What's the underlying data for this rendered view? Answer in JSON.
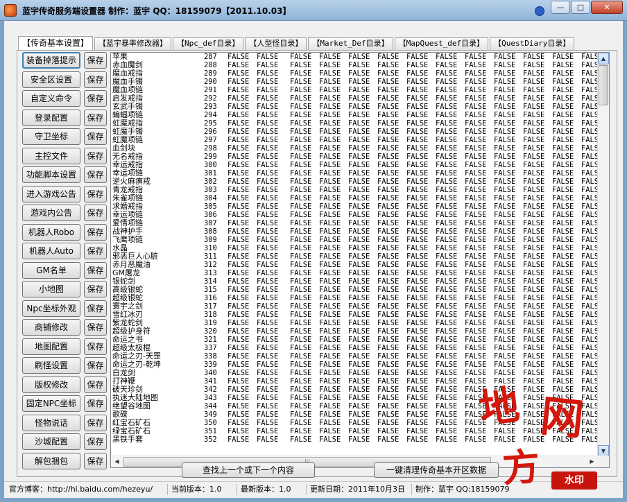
{
  "window": {
    "title": "蓝宇传奇服务端设置器 制作：蓝宇 QQ：18159079【2011.10.03】",
    "min_glyph": "—",
    "max_glyph": "□",
    "close_glyph": "✕"
  },
  "tabs": [
    {
      "label": "【传奇基本设置】"
    },
    {
      "label": "【蓝宇暴率修改器】"
    },
    {
      "label": "【Npc_def目录】"
    },
    {
      "label": "【人型怪目录】"
    },
    {
      "label": "【Market_Def目录】"
    },
    {
      "label": "【MapQuest_def目录】"
    },
    {
      "label": "【QuestDiary目录】"
    }
  ],
  "left_buttons": [
    {
      "label": "装备掉落提示",
      "save": "保存"
    },
    {
      "label": "安全区设置",
      "save": "保存"
    },
    {
      "label": "自定义命令",
      "save": "保存"
    },
    {
      "label": "登录配置",
      "save": "保存"
    },
    {
      "label": "守卫坐标",
      "save": "保存"
    },
    {
      "label": "主控文件",
      "save": "保存"
    },
    {
      "label": "功能脚本设置",
      "save": "保存"
    },
    {
      "label": "进入游戏公告",
      "save": "保存"
    },
    {
      "label": "游戏内公告",
      "save": "保存"
    },
    {
      "label": "机器人Robo",
      "save": "保存"
    },
    {
      "label": "机器人Auto",
      "save": "保存"
    },
    {
      "label": "GM名单",
      "save": "保存"
    },
    {
      "label": "小地图",
      "save": "保存"
    },
    {
      "label": "Npc坐标外观",
      "save": "保存"
    },
    {
      "label": "商铺修改",
      "save": "保存"
    },
    {
      "label": "地图配置",
      "save": "保存"
    },
    {
      "label": "刷怪设置",
      "save": "保存"
    },
    {
      "label": "版权修改",
      "save": "保存"
    },
    {
      "label": "固定NPC坐标",
      "save": "保存"
    },
    {
      "label": "怪物说话",
      "save": "保存"
    },
    {
      "label": "沙城配置",
      "save": "保存"
    },
    {
      "label": "解包捆包",
      "save": "保存"
    }
  ],
  "list": {
    "flag_value": "FALSE",
    "flag_columns": 13,
    "rows": [
      {
        "name": "苹果",
        "num": "287"
      },
      {
        "name": "赤血魔剑",
        "num": "288"
      },
      {
        "name": "魔血戒指",
        "num": "289"
      },
      {
        "name": "魔血手镯",
        "num": "290"
      },
      {
        "name": "魔血项链",
        "num": "291"
      },
      {
        "name": "启发戒指",
        "num": "292"
      },
      {
        "name": "玄武手镯",
        "num": "293"
      },
      {
        "name": "蝙蝠项链",
        "num": "294"
      },
      {
        "name": "虹魔戒指",
        "num": "295"
      },
      {
        "name": "虹魔手镯",
        "num": "296"
      },
      {
        "name": "虹魔项链",
        "num": "297"
      },
      {
        "name": "血剑块",
        "num": "298"
      },
      {
        "name": "无名戒指",
        "num": "299"
      },
      {
        "name": "幸运戒指",
        "num": "300"
      },
      {
        "name": "幸运项链",
        "num": "301"
      },
      {
        "name": "逆火麻痹戒",
        "num": "302"
      },
      {
        "name": "青龙戒指",
        "num": "303"
      },
      {
        "name": "朱雀项链",
        "num": "304"
      },
      {
        "name": "求婚戒指",
        "num": "305"
      },
      {
        "name": "幸运项链",
        "num": "306"
      },
      {
        "name": "爱情项链",
        "num": "307"
      },
      {
        "name": "战神护手",
        "num": "308"
      },
      {
        "name": "飞鹰项链",
        "num": "309"
      },
      {
        "name": "水晶",
        "num": "310"
      },
      {
        "name": "邪恶巨人心脏",
        "num": "311"
      },
      {
        "name": "赤月恶魔油",
        "num": "312"
      },
      {
        "name": "GM屠龙",
        "num": "313"
      },
      {
        "name": "银蛇剑",
        "num": "314"
      },
      {
        "name": "高级银蛇",
        "num": "315"
      },
      {
        "name": "超级银蛇",
        "num": "316"
      },
      {
        "name": "寰宇之剑",
        "num": "317"
      },
      {
        "name": "雪红冰刃",
        "num": "318"
      },
      {
        "name": "紫龙蛇剑",
        "num": "319"
      },
      {
        "name": "超级护身符",
        "num": "320"
      },
      {
        "name": "命运之书",
        "num": "321"
      },
      {
        "name": "超级太极棍",
        "num": "337"
      },
      {
        "name": "命运之刃-天罡",
        "num": "338"
      },
      {
        "name": "命运之刃-乾坤",
        "num": "339"
      },
      {
        "name": "白龙剑",
        "num": "340"
      },
      {
        "name": "打神鞭",
        "num": "341"
      },
      {
        "name": "破天珍剑",
        "num": "342"
      },
      {
        "name": "执迷大陆地图",
        "num": "343"
      },
      {
        "name": "绝望谷地图",
        "num": "344"
      },
      {
        "name": "歌碟",
        "num": "349"
      },
      {
        "name": "红宝石矿石",
        "num": "350"
      },
      {
        "name": "绿宝石矿石",
        "num": "351"
      },
      {
        "name": "黑铁手套",
        "num": "352"
      }
    ]
  },
  "scroll": {
    "up": "▲",
    "down": "▼",
    "left": "◀",
    "right": "▶",
    "grip": "≡",
    "hgrip": "|||"
  },
  "bottom_buttons": {
    "find": "查找上一个或下一个内容",
    "clean": "一键清理传奇基本开区数据"
  },
  "status": {
    "blog": "官方博客：http://hi.baidu.com/hezeyu/",
    "current_version": "当前版本：1.0",
    "latest_version": "最新版本：1.0",
    "update_date": "更新日期：2011年10月3日",
    "author": "制作：蓝宇 QQ:18159079"
  },
  "watermark": {
    "char1": "地",
    "char2": "网",
    "char3": "方",
    "badge": "水印"
  }
}
